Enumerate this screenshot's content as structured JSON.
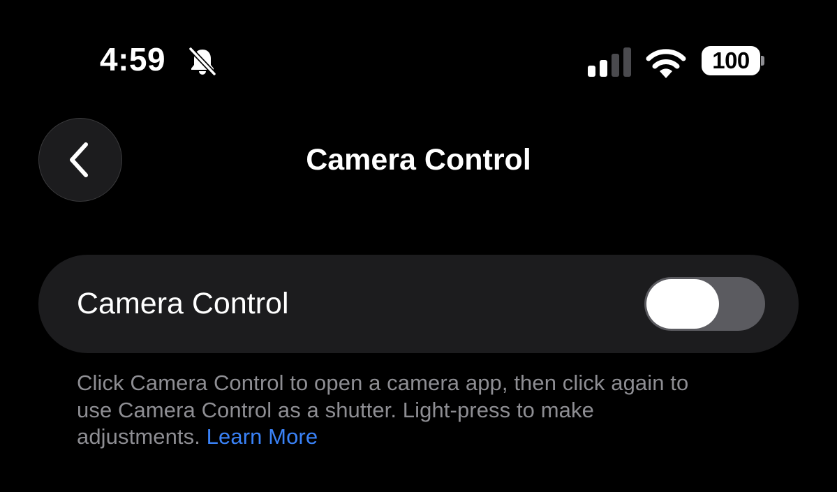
{
  "status_bar": {
    "time": "4:59",
    "bell_icon": "bell-slash-icon",
    "signal_icon": "cellular-signal-icon",
    "wifi_icon": "wifi-icon",
    "battery_level": "100"
  },
  "nav": {
    "back_icon": "chevron-left-icon",
    "title": "Camera Control"
  },
  "settings": {
    "camera_control": {
      "label": "Camera Control",
      "enabled": false
    }
  },
  "footer": {
    "line1": "Click Camera Control to open a camera app, then click again to",
    "line2": "use Camera Control as a shutter. Light-press to make",
    "line3_prefix": "adjustments. ",
    "link": "Learn More"
  },
  "colors": {
    "background": "#000000",
    "group_background": "#1c1c1e",
    "secondary_text": "#8e8e93",
    "link": "#3a82f7",
    "toggle_off": "#5b5b60"
  }
}
